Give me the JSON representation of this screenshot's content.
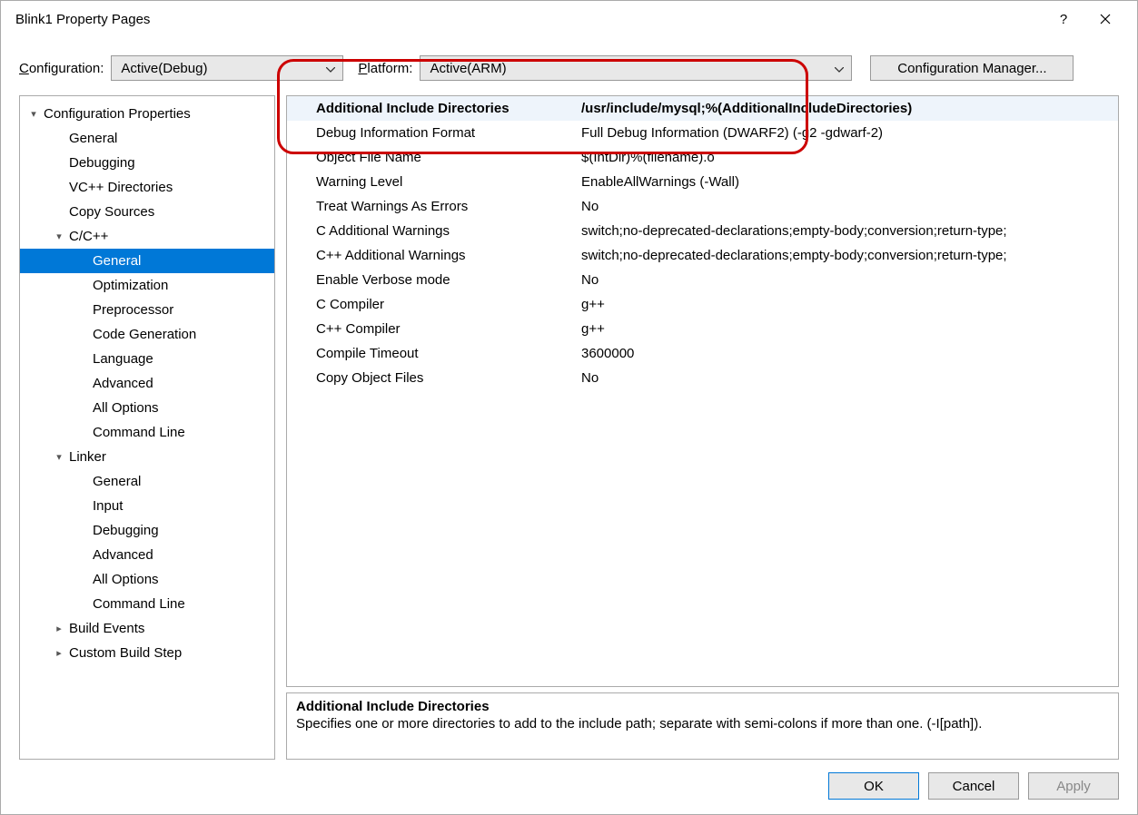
{
  "window": {
    "title": "Blink1 Property Pages"
  },
  "toolbar": {
    "config_label": "Configuration:",
    "config_value": "Active(Debug)",
    "platform_label": "Platform:",
    "platform_value": "Active(ARM)",
    "config_mgr_label": "Configuration Manager..."
  },
  "tree": [
    {
      "label": "Configuration Properties",
      "indent": 0,
      "exp": "▾"
    },
    {
      "label": "General",
      "indent": 1
    },
    {
      "label": "Debugging",
      "indent": 1
    },
    {
      "label": "VC++ Directories",
      "indent": 1
    },
    {
      "label": "Copy Sources",
      "indent": 1
    },
    {
      "label": "C/C++",
      "indent": 1,
      "exp": "▾"
    },
    {
      "label": "General",
      "indent": 2,
      "selected": true
    },
    {
      "label": "Optimization",
      "indent": 2
    },
    {
      "label": "Preprocessor",
      "indent": 2
    },
    {
      "label": "Code Generation",
      "indent": 2
    },
    {
      "label": "Language",
      "indent": 2
    },
    {
      "label": "Advanced",
      "indent": 2
    },
    {
      "label": "All Options",
      "indent": 2
    },
    {
      "label": "Command Line",
      "indent": 2
    },
    {
      "label": "Linker",
      "indent": 1,
      "exp": "▾"
    },
    {
      "label": "General",
      "indent": 2
    },
    {
      "label": "Input",
      "indent": 2
    },
    {
      "label": "Debugging",
      "indent": 2
    },
    {
      "label": "Advanced",
      "indent": 2
    },
    {
      "label": "All Options",
      "indent": 2
    },
    {
      "label": "Command Line",
      "indent": 2
    },
    {
      "label": "Build Events",
      "indent": 1,
      "exp": "▸"
    },
    {
      "label": "Custom Build Step",
      "indent": 1,
      "exp": "▸"
    }
  ],
  "props": [
    {
      "name": "Additional Include Directories",
      "value": "/usr/include/mysql;%(AdditionalIncludeDirectories)",
      "bold": true,
      "highlighted": true
    },
    {
      "name": "Debug Information Format",
      "value": "Full Debug Information (DWARF2) (-g2 -gdwarf-2)"
    },
    {
      "name": "Object File Name",
      "value": "$(IntDir)%(filename).o"
    },
    {
      "name": "Warning Level",
      "value": "EnableAllWarnings (-Wall)"
    },
    {
      "name": "Treat Warnings As Errors",
      "value": "No"
    },
    {
      "name": "C Additional Warnings",
      "value": "switch;no-deprecated-declarations;empty-body;conversion;return-type;"
    },
    {
      "name": "C++ Additional Warnings",
      "value": "switch;no-deprecated-declarations;empty-body;conversion;return-type;"
    },
    {
      "name": "Enable Verbose mode",
      "value": "No"
    },
    {
      "name": "C Compiler",
      "value": "g++"
    },
    {
      "name": "C++ Compiler",
      "value": "g++"
    },
    {
      "name": "Compile Timeout",
      "value": "3600000"
    },
    {
      "name": "Copy Object Files",
      "value": "No"
    }
  ],
  "desc": {
    "title": "Additional Include Directories",
    "text": "Specifies one or more directories to add to the include path; separate with semi-colons if more than one. (-I[path])."
  },
  "footer": {
    "ok": "OK",
    "cancel": "Cancel",
    "apply": "Apply"
  }
}
